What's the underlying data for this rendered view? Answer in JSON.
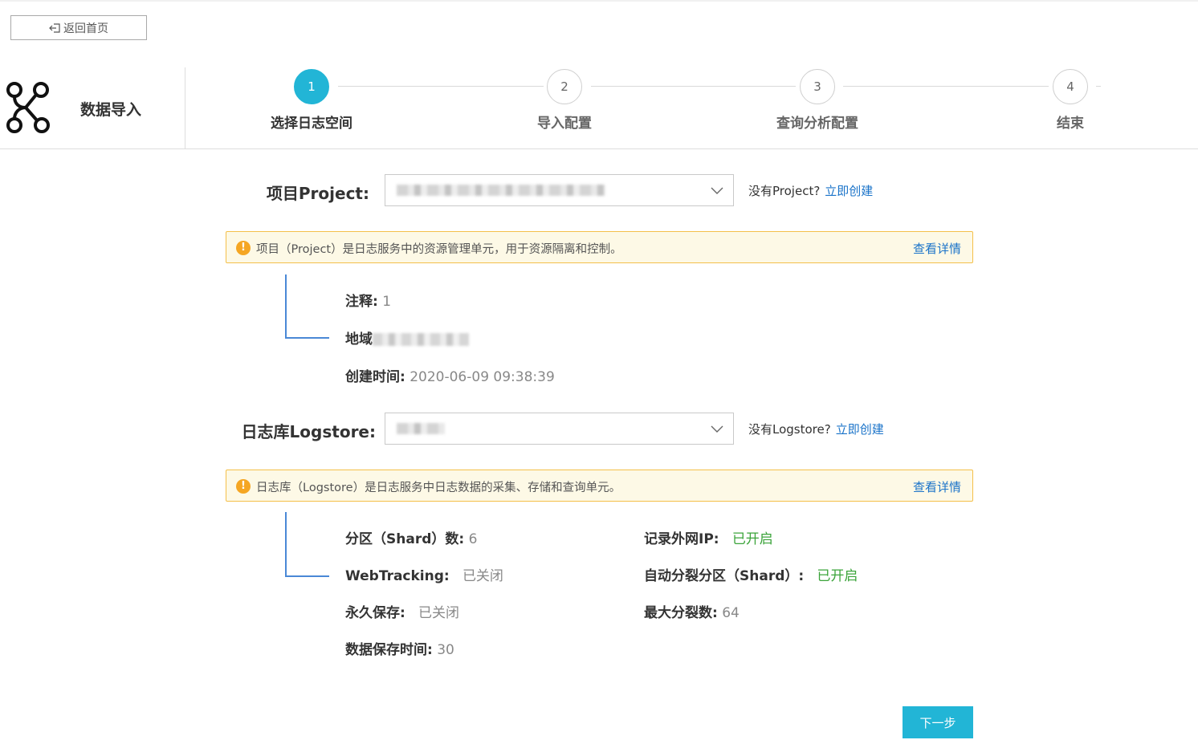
{
  "nav": {
    "back_label": "返回首页"
  },
  "header": {
    "app_title": "数据导入"
  },
  "steps": [
    {
      "num": "1",
      "label": "选择日志空间",
      "active": true
    },
    {
      "num": "2",
      "label": "导入配置",
      "active": false
    },
    {
      "num": "3",
      "label": "查询分析配置",
      "active": false
    },
    {
      "num": "4",
      "label": "结束",
      "active": false
    }
  ],
  "project": {
    "label": "项目Project:",
    "hint_text": "没有Project?",
    "create_link": "立即创建",
    "notice_text": "项目（Project）是日志服务中的资源管理单元，用于资源隔离和控制。",
    "notice_link": "查看详情",
    "details": {
      "comment_key": "注释:",
      "comment_val": "1",
      "region_key": "地域",
      "created_key": "创建时间:",
      "created_val": "2020-06-09 09:38:39"
    }
  },
  "logstore": {
    "label": "日志库Logstore:",
    "hint_text": "没有Logstore?",
    "create_link": "立即创建",
    "notice_text": "日志库（Logstore）是日志服务中日志数据的采集、存储和查询单元。",
    "notice_link": "查看详情",
    "details": {
      "shard_key": "分区（Shard）数:",
      "shard_val": "6",
      "webtracking_key": "WebTracking:",
      "webtracking_val": "已关闭",
      "permanent_key": "永久保存:",
      "permanent_val": "已关闭",
      "retention_key": "数据保存时间:",
      "retention_val": "30",
      "ip_key": "记录外网IP:",
      "ip_val": "已开启",
      "autosplit_key": "自动分裂分区（Shard）:",
      "autosplit_val": "已开启",
      "maxsplit_key": "最大分裂数:",
      "maxsplit_val": "64"
    }
  },
  "footer": {
    "next_label": "下一步"
  },
  "colors": {
    "accent": "#22b5d6",
    "link": "#1a73c9",
    "enabled": "#3ca43b",
    "warning": "#f5a623"
  }
}
